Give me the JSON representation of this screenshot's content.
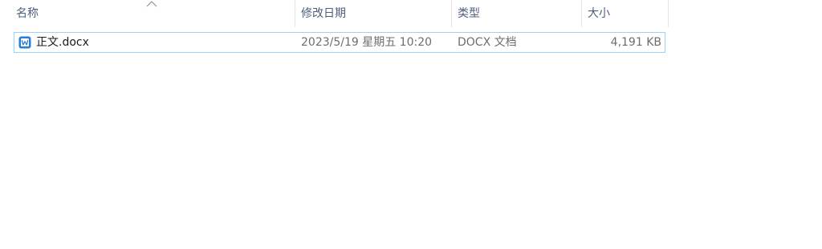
{
  "columns": {
    "name": "名称",
    "date_modified": "修改日期",
    "type": "类型",
    "size": "大小"
  },
  "sort": {
    "column": "name",
    "icon": "sort-ascending-chevron"
  },
  "files": [
    {
      "name": "正文.docx",
      "date_modified": "2023/5/19 星期五 10:20",
      "type": "DOCX 文档",
      "size": "4,191 KB",
      "icon": "word-document-icon",
      "selected": true
    }
  ],
  "colors": {
    "header_text": "#4c607a",
    "selection_border": "#99d1ff",
    "icon_blue": "#2b7cd3"
  }
}
